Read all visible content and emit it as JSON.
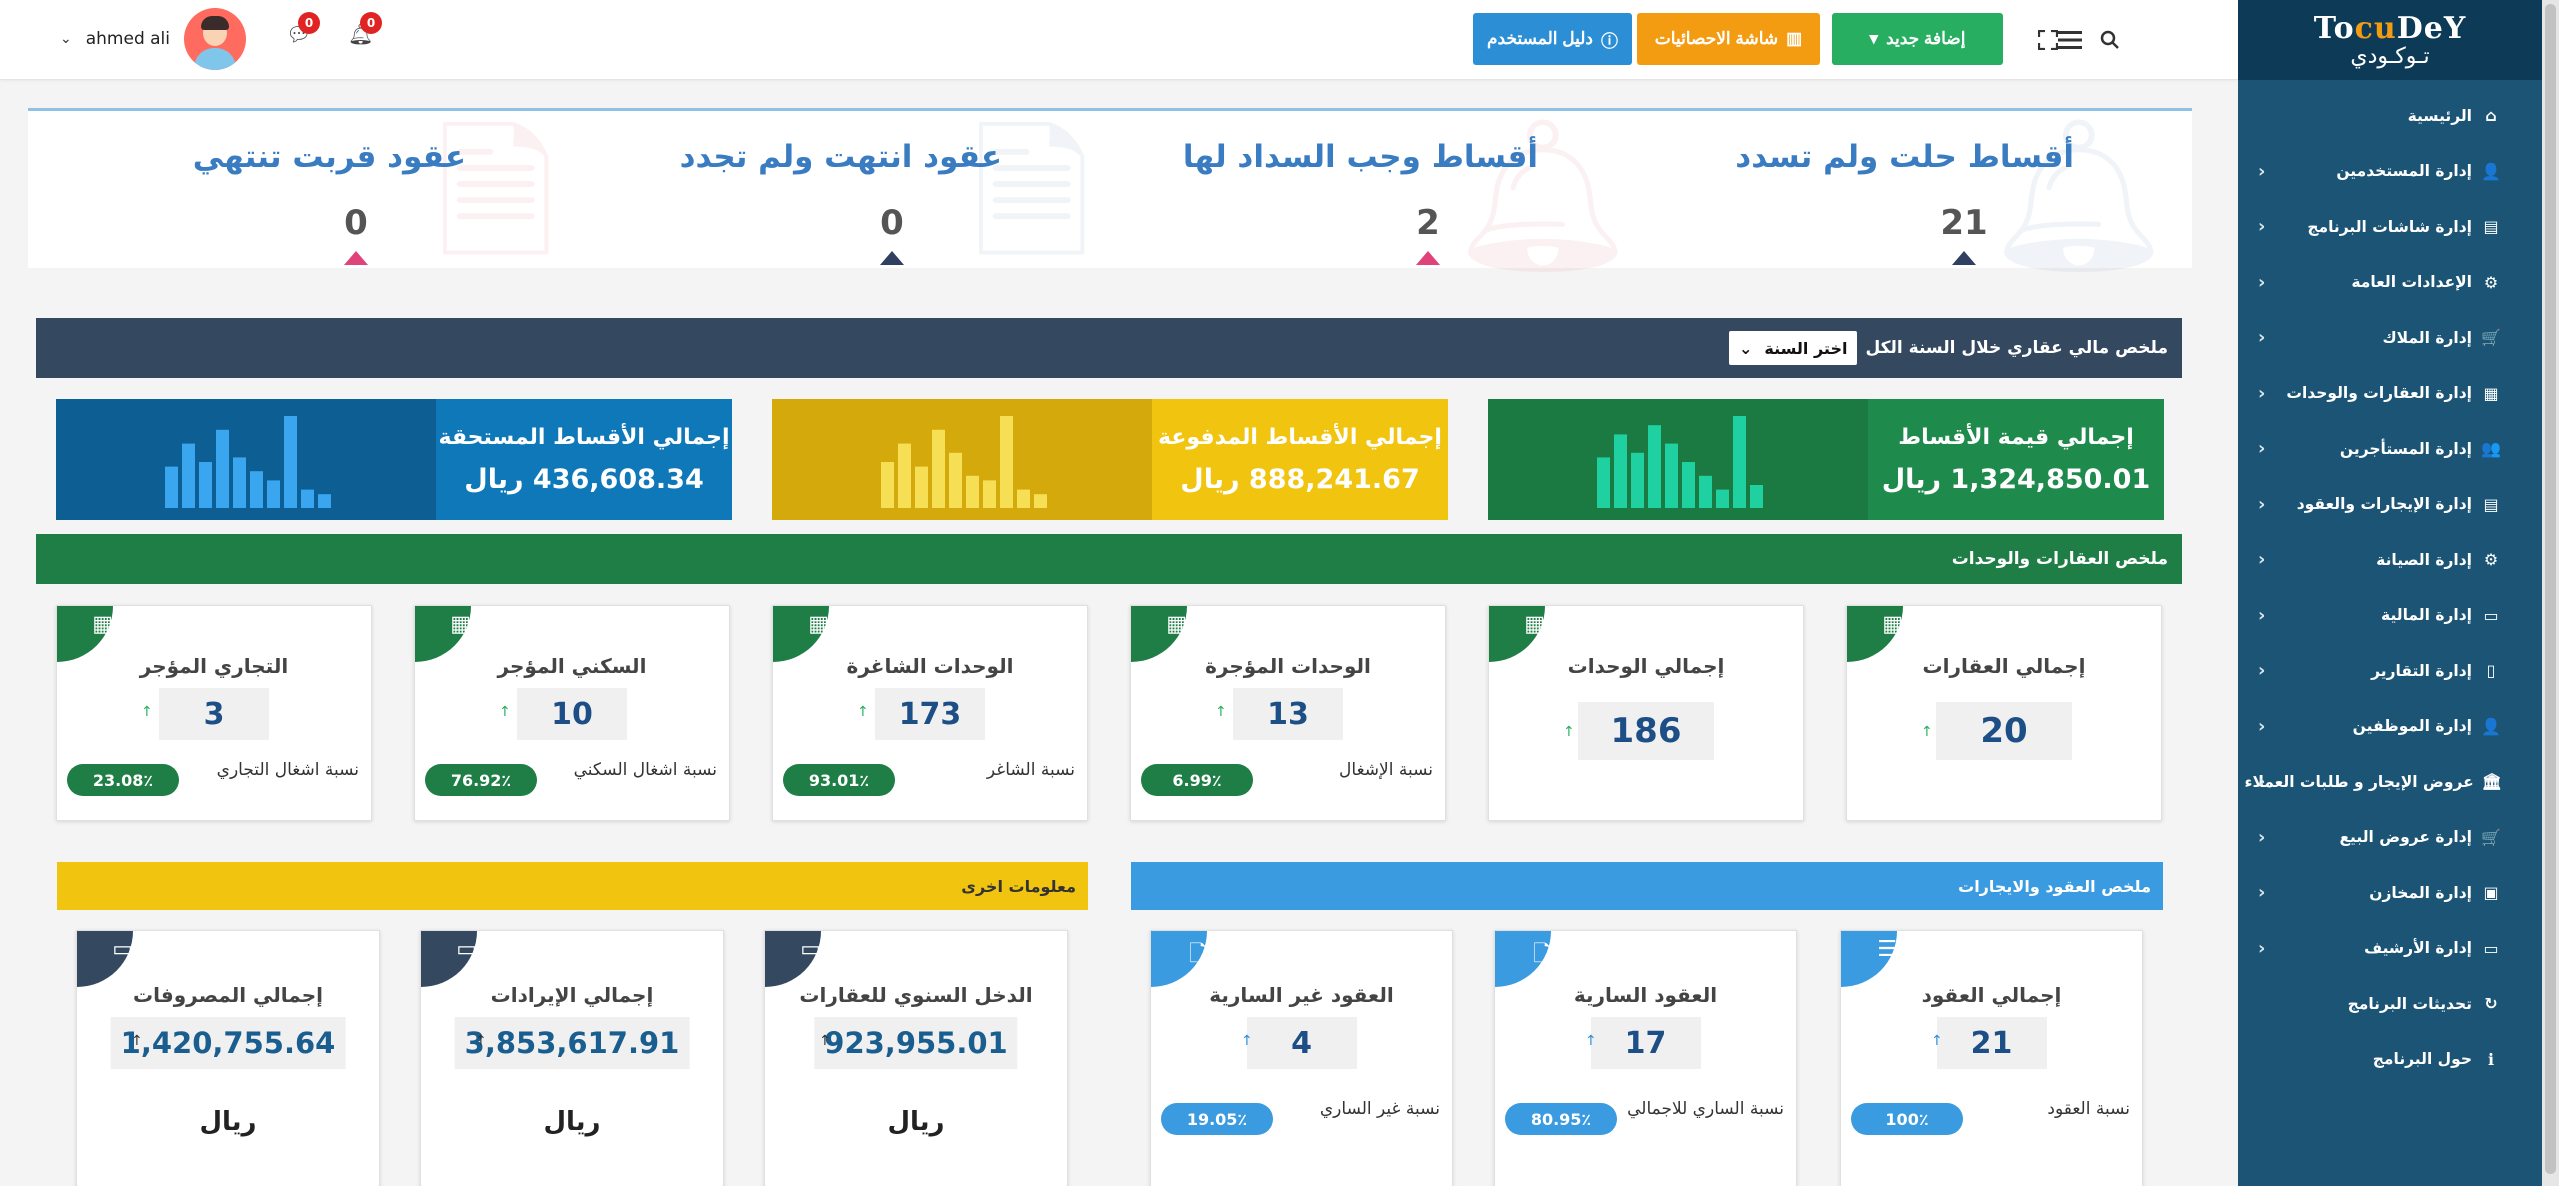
{
  "sidebar": {
    "logo_latin": "TocuDeY",
    "logo_arabic": "تـوكـودي",
    "items": [
      {
        "label": "الرئيسية",
        "icon": "home-icon",
        "glyph": "⌂",
        "has_sub": false
      },
      {
        "label": "إدارة المستخدمين",
        "icon": "user-plus-icon",
        "glyph": "👤",
        "has_sub": true
      },
      {
        "label": "إدارة شاشات البرنامج",
        "icon": "file-icon",
        "glyph": "▤",
        "has_sub": true
      },
      {
        "label": "الإعدادات العامة",
        "icon": "gear-icon",
        "glyph": "⚙",
        "has_sub": true
      },
      {
        "label": "إدارة الملاك",
        "icon": "cart-icon",
        "glyph": "🛒",
        "has_sub": true
      },
      {
        "label": "إدارة العقارات والوحدات",
        "icon": "building-icon",
        "glyph": "▦",
        "has_sub": true
      },
      {
        "label": "إدارة المستأجرين",
        "icon": "users-icon",
        "glyph": "👥",
        "has_sub": true
      },
      {
        "label": "إدارة الإيجارات والعقود",
        "icon": "file-text-icon",
        "glyph": "▤",
        "has_sub": true
      },
      {
        "label": "إدارة الصيانة",
        "icon": "cogs-icon",
        "glyph": "⚙",
        "has_sub": true
      },
      {
        "label": "إدارة المالية",
        "icon": "money-icon",
        "glyph": "▭",
        "has_sub": true
      },
      {
        "label": "إدارة التقارير",
        "icon": "report-icon",
        "glyph": "▯",
        "has_sub": true
      },
      {
        "label": "إدارة الموظفين",
        "icon": "employee-icon",
        "glyph": "👤",
        "has_sub": true
      },
      {
        "label": "عروض الإيجار و طلبات العملاء",
        "icon": "bank-icon",
        "glyph": "🏛",
        "has_sub": true
      },
      {
        "label": "إدارة عروض البيع",
        "icon": "shopping-cart-icon",
        "glyph": "🛒",
        "has_sub": true
      },
      {
        "label": "إدارة المخازن",
        "icon": "basket-icon",
        "glyph": "▣",
        "has_sub": true
      },
      {
        "label": "إدارة الأرشيف",
        "icon": "archive-icon",
        "glyph": "▭",
        "has_sub": true
      },
      {
        "label": "تحديثات البرنامج",
        "icon": "refresh-icon",
        "glyph": "↻",
        "has_sub": false
      },
      {
        "label": "حول البرنامج",
        "icon": "info-icon",
        "glyph": "ℹ",
        "has_sub": false
      }
    ]
  },
  "topbar": {
    "add_new_label": "إضافة جديد",
    "stats_label": "شاشة الاحصائيات",
    "guide_label": "دليل المستخدم",
    "user_name": "ahmed ali",
    "messages_count": "0",
    "notifications_count": "0"
  },
  "alerts": [
    {
      "title": "أقساط حلت ولم تسدد",
      "value": "21",
      "color": "#3a7cc1",
      "tri": "#2f4060",
      "icon_color": "#8ea3c0"
    },
    {
      "title": "أقساط وجب السداد لها",
      "value": "2",
      "color": "#3a7cc1",
      "tri": "#e0427a",
      "icon_color": "#e58a9a"
    },
    {
      "title": "عقود انتهت ولم تجدد",
      "value": "0",
      "color": "#3a7cc1",
      "tri": "#2f4060",
      "icon_color": "#8ea3c0"
    },
    {
      "title": "عقود قربت تنتهي",
      "value": "0",
      "color": "#3a7cc1",
      "tri": "#e0427a",
      "icon_color": "#e58a9a"
    }
  ],
  "financial": {
    "header_label": "ملخص مالي عقاري خلال السنة الكل",
    "year_select": "اختر السنة",
    "cards": [
      {
        "title": "إجمالي قيمة الأقساط",
        "value": "1,324,850.01 ريال",
        "bg": "#1e8a4b",
        "chart_bg": "#1a7a42",
        "bar": "#1fd1a0",
        "bars": [
          0.55,
          0.8,
          0.6,
          0.9,
          0.7,
          0.5,
          0.35,
          0.2,
          1.0,
          0.25
        ]
      },
      {
        "title": "إجمالي الأقساط المدفوعة",
        "value": "888,241.67 ريال",
        "bg": "#f1c40f",
        "chart_bg": "#d4a90c",
        "bar": "#f7df55",
        "bars": [
          0.5,
          0.7,
          0.45,
          0.85,
          0.6,
          0.35,
          0.3,
          1.0,
          0.2,
          0.15
        ]
      },
      {
        "title": "إجمالي الأقساط المستحقة",
        "value": "436,608.34 ريال",
        "bg": "#0f78b9",
        "chart_bg": "#0d5e92",
        "bar": "#3aa6f0",
        "bars": [
          0.45,
          0.7,
          0.5,
          0.85,
          0.55,
          0.4,
          0.3,
          1.0,
          0.2,
          0.15
        ]
      }
    ]
  },
  "properties": {
    "header_label": "ملخص العقارات والوحدات",
    "cards": [
      {
        "title": "إجمالي العقارات",
        "value": "20",
        "label": "",
        "pill": "",
        "big": true
      },
      {
        "title": "إجمالي الوحدات",
        "value": "186",
        "label": "",
        "pill": "",
        "big": true
      },
      {
        "title": "الوحدات المؤجرة",
        "value": "13",
        "label": "نسبة الإشغال",
        "pill": "6.99٪",
        "big": false
      },
      {
        "title": "الوحدات الشاغرة",
        "value": "173",
        "label": "نسبة الشاغر",
        "pill": "93.01٪",
        "big": false
      },
      {
        "title": "السكني المؤجر",
        "value": "10",
        "label": "نسبة اشغال السكني",
        "pill": "76.92٪",
        "big": false
      },
      {
        "title": "التجاري المؤجر",
        "value": "3",
        "label": "نسبة اشغال التجاري",
        "pill": "23.08٪",
        "big": false
      }
    ]
  },
  "contracts": {
    "header_label": "ملخص العقود والايجارات",
    "cards": [
      {
        "title": "إجمالي العقود",
        "value": "21",
        "label": "نسبة العقود",
        "pill": "100٪"
      },
      {
        "title": "العقود السارية",
        "value": "17",
        "label": "نسبة الساري للاجمالي",
        "pill": "80.95٪"
      },
      {
        "title": "العقود غير السارية",
        "value": "4",
        "label": "نسبة غير الساري",
        "pill": "19.05٪"
      }
    ]
  },
  "other": {
    "header_label": "معلومات اخرى",
    "currency": "ريال",
    "cards": [
      {
        "title": "الدخل السنوي للعقارات",
        "value": "923,955.01"
      },
      {
        "title": "إجمالي الإيرادات",
        "value": "3,853,617.91"
      },
      {
        "title": "إجمالي المصروفات",
        "value": "1,420,755.64"
      }
    ]
  },
  "colors": {
    "sidebar": "#1b5474",
    "green": "#1e7e46",
    "blue": "#3a9be0",
    "navy": "#344860",
    "yellow": "#f1c40f"
  }
}
